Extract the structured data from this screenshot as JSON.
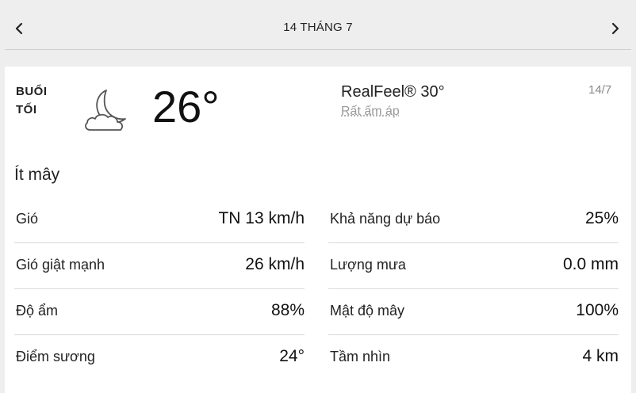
{
  "header": {
    "date_title": "14 THÁNG 7",
    "prev_icon": "chevron-left-icon",
    "next_icon": "chevron-right-icon"
  },
  "current": {
    "period_line1": "BUỔI",
    "period_line2": "TỐI",
    "icon": "partly-cloudy-night-icon",
    "temperature": "26°",
    "realfeel": "RealFeel® 30°",
    "realfeel_desc": "Rất ấm áp",
    "short_date": "14/7",
    "condition": "Ít mây"
  },
  "details": {
    "left": [
      {
        "label": "Gió",
        "value": "TN 13 km/h"
      },
      {
        "label": "Gió giật mạnh",
        "value": "26 km/h"
      },
      {
        "label": "Độ ẩm",
        "value": "88%"
      },
      {
        "label": "Điểm sương",
        "value": "24°"
      }
    ],
    "right": [
      {
        "label": "Khả năng dự báo",
        "value": "25%"
      },
      {
        "label": "Lượng mưa",
        "value": "0.0 mm"
      },
      {
        "label": "Mật độ mây",
        "value": "100%"
      },
      {
        "label": "Tầm nhìn",
        "value": "4 km"
      }
    ]
  },
  "colors": {
    "page_bg": "#eeeeee",
    "card_bg": "#ffffff",
    "muted_text": "#999999"
  }
}
